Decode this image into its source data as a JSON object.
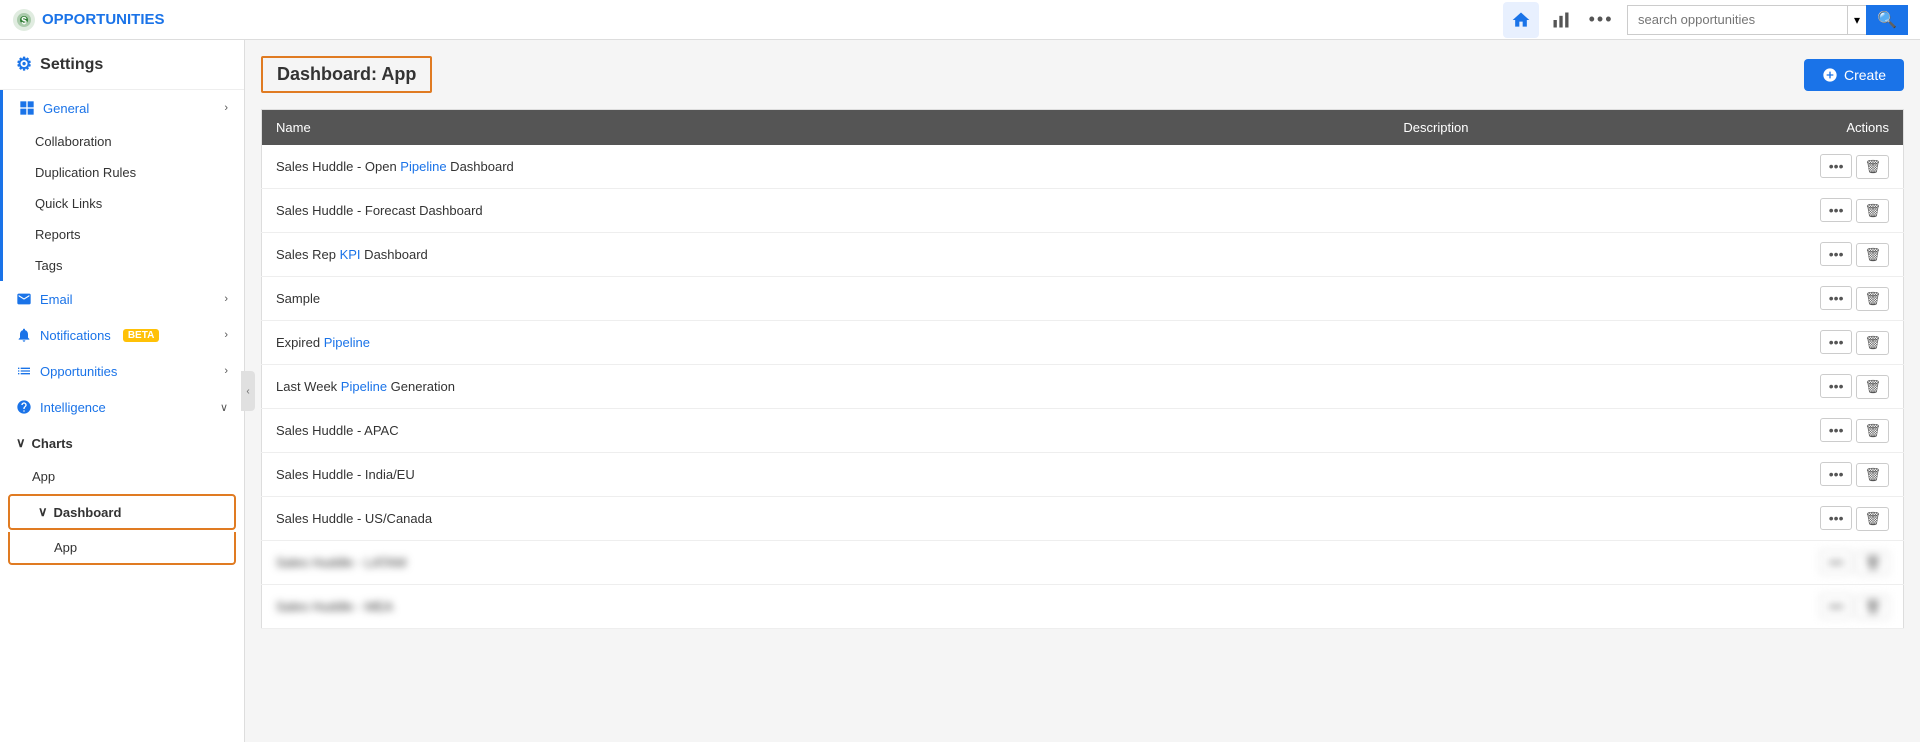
{
  "app": {
    "title": "OPPORTUNITIES"
  },
  "topnav": {
    "search_placeholder": "search opportunities",
    "search_btn_label": "🔍"
  },
  "sidebar": {
    "settings_label": "Settings",
    "general_label": "General",
    "sub_items": [
      "Collaboration",
      "Duplication Rules",
      "Quick Links",
      "Reports",
      "Tags"
    ],
    "email_label": "Email",
    "notifications_label": "Notifications",
    "beta_label": "BETA",
    "opportunities_label": "Opportunities",
    "intelligence_label": "Intelligence",
    "charts_label": "Charts",
    "charts_app_label": "App",
    "dashboard_label": "Dashboard",
    "dashboard_app_label": "App"
  },
  "main": {
    "page_title": "Dashboard: App",
    "create_btn": "Create",
    "table": {
      "columns": [
        "Name",
        "Description",
        "Actions"
      ],
      "rows": [
        {
          "name": "Sales Huddle - Open Pipeline Dashboard",
          "description": ""
        },
        {
          "name": "Sales Huddle - Forecast Dashboard",
          "description": ""
        },
        {
          "name": "Sales Rep KPI Dashboard",
          "description": ""
        },
        {
          "name": "Sample",
          "description": ""
        },
        {
          "name": "Expired Pipeline",
          "description": ""
        },
        {
          "name": "Last Week Pipeline Generation",
          "description": ""
        },
        {
          "name": "Sales Huddle - APAC",
          "description": ""
        },
        {
          "name": "Sales Huddle - India/EU",
          "description": ""
        },
        {
          "name": "Sales Huddle - US/Canada",
          "description": ""
        },
        {
          "name": "Sales Huddle - LATAM",
          "description": ""
        },
        {
          "name": "Sales Huddle - MEA",
          "description": ""
        }
      ]
    }
  }
}
